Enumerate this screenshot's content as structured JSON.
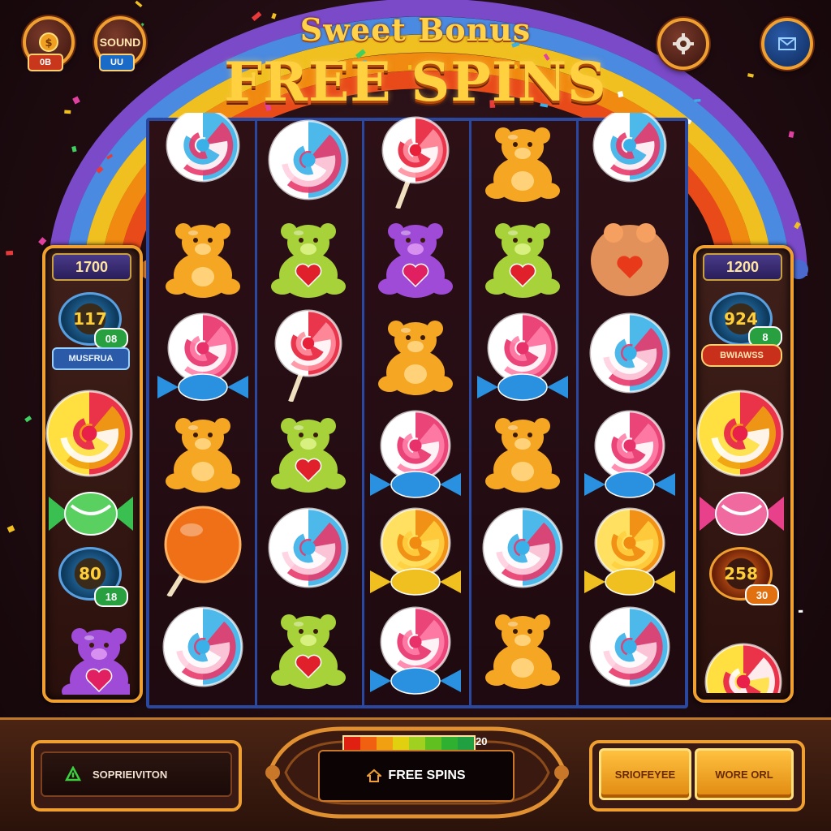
{
  "header": {
    "title_line1": "Sweet Bonus",
    "title_line2": "FREE SPINS",
    "left_buttons": [
      {
        "name": "coin-button",
        "icon": "coin-icon",
        "badge": "0B",
        "badge_color": "#c8361c"
      },
      {
        "name": "sound-button",
        "label": "SOUND",
        "badge": "UU",
        "badge_color": "#1a6ac8"
      }
    ],
    "right_buttons": [
      {
        "name": "settings-button",
        "icon": "gear-icon"
      },
      {
        "name": "info-button",
        "icon": "mail-icon"
      }
    ]
  },
  "left_panel": {
    "top_value": "1700",
    "gauge1_value": "117",
    "gauge1_badge": "08",
    "label": "MUSFRUA",
    "gauge2_value": "80",
    "gauge2_badge": "18"
  },
  "right_panel": {
    "top_value": "1200",
    "gauge1_value": "924",
    "gauge1_badge": "8",
    "label": "BWIAWSS",
    "gauge2_value": "258",
    "gauge2_badge": "30"
  },
  "reels": {
    "columns": 5,
    "rows": 6,
    "grid": [
      [
        "partial",
        "swirl_lollipop",
        "stick_lollipop",
        "orange_bear",
        "partial"
      ],
      [
        "orange_bear",
        "green_bear",
        "purple_bear",
        "green_bear",
        "gummy_orange"
      ],
      [
        "pink_lollipop",
        "stick_lollipop",
        "orange_bear",
        "pink_lollipop",
        "swirl_lollipop"
      ],
      [
        "orange_bear",
        "green_bear",
        "pink_lollipop",
        "orange_bear",
        "pink_lollipop"
      ],
      [
        "orange_lollipop",
        "swirl_lollipop",
        "yellow_lollipop",
        "swirl_lollipop",
        "yellow_lollipop"
      ],
      [
        "swirl_lollipop",
        "green_bear",
        "pink_lollipop",
        "orange_bear",
        "swirl_lollipop"
      ]
    ]
  },
  "bottom": {
    "left_label": "SOPRIEIVITON",
    "left_icon": "arrow-up-icon",
    "progress_value": "20",
    "progress_colors": [
      "#e02010",
      "#f06010",
      "#f0a010",
      "#e0d010",
      "#a0d020",
      "#60c020",
      "#30b030",
      "#20a040"
    ],
    "center_icon": "home-icon",
    "center_label": "FREE SPINS",
    "btn1_label": "SRIOFEYEE",
    "btn2_label": "WORE ORL"
  },
  "colors": {
    "accent_gold": "#f0a030",
    "reel_border": "#2a48a0",
    "background": "#200c12"
  }
}
